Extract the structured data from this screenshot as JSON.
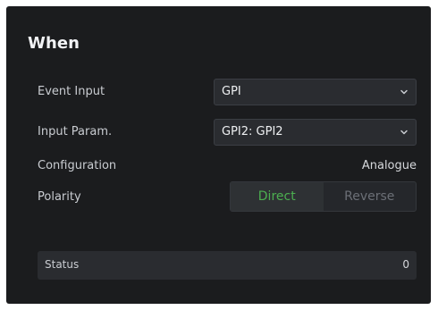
{
  "panel": {
    "title": "When"
  },
  "rows": {
    "event_input": {
      "label": "Event Input",
      "value": "GPI",
      "icon": "chevron-down-icon"
    },
    "input_param": {
      "label": "Input Param.",
      "value": "GPI2: GPI2",
      "icon": "chevron-down-icon"
    },
    "configuration": {
      "label": "Configuration",
      "value": "Analogue"
    },
    "polarity": {
      "label": "Polarity",
      "options": [
        "Direct",
        "Reverse"
      ],
      "selected": "Direct",
      "active_color": "#4caf50"
    }
  },
  "status": {
    "label": "Status",
    "value": "0"
  }
}
